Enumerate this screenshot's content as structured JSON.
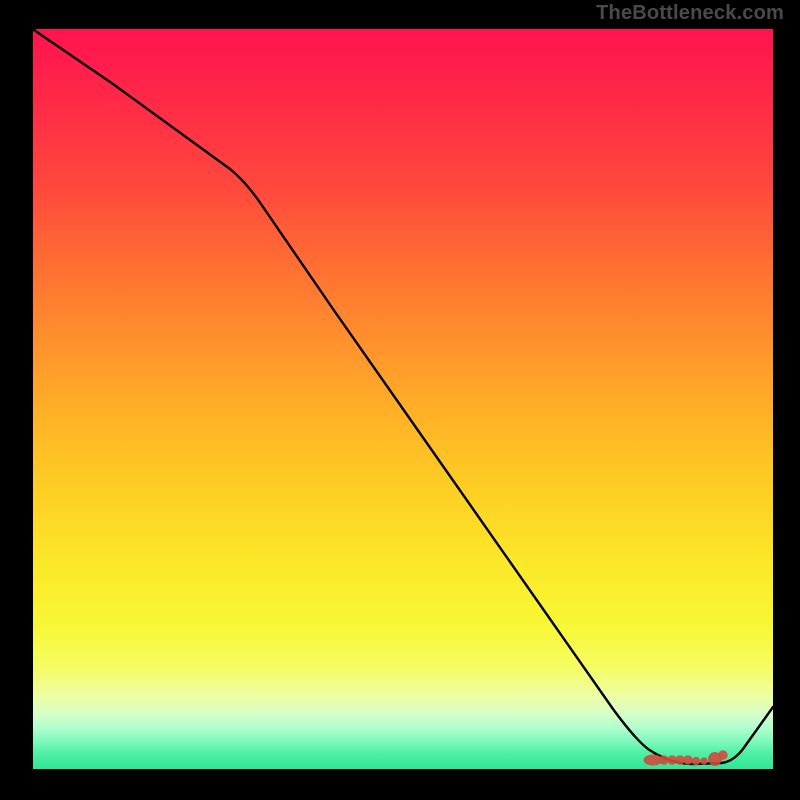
{
  "attribution": "TheBottleneck.com",
  "chart_data": {
    "type": "line",
    "title": "",
    "xlabel": "",
    "ylabel": "",
    "xlim": [
      0,
      100
    ],
    "ylim": [
      0,
      100
    ],
    "grid": false,
    "legend": false,
    "series": [
      {
        "name": "curve",
        "x": [
          0,
          10,
          22,
          30,
          40,
          50,
          60,
          70,
          80,
          83,
          86,
          89,
          92,
          100
        ],
        "values": [
          100,
          92,
          82,
          73,
          60,
          47,
          34,
          21,
          8,
          3,
          1.5,
          1,
          1,
          12
        ]
      }
    ],
    "markers": {
      "name": "dot-cluster",
      "x": [
        83.5,
        85,
        86.2,
        87.3,
        88.2,
        91.2
      ],
      "values": [
        1.2,
        1.1,
        1.0,
        1.0,
        1.0,
        1.3
      ],
      "style": "red-dots"
    },
    "colors": {
      "gradient_top": "#ff1350",
      "gradient_mid": "#fece24",
      "gradient_bottom": "#30e695",
      "curve": "#000000",
      "markers": "#d24b3e"
    }
  }
}
